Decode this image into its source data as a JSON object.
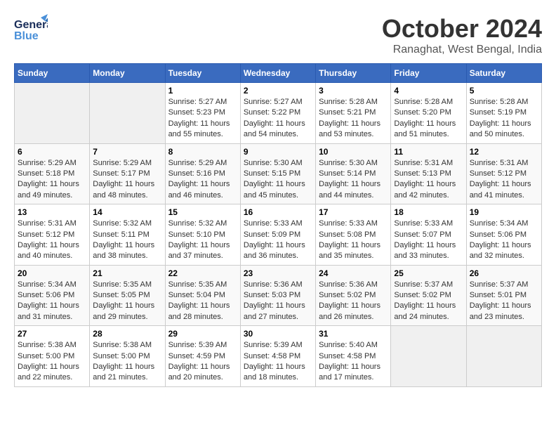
{
  "header": {
    "logo_general": "General",
    "logo_blue": "Blue",
    "month": "October 2024",
    "location": "Ranaghat, West Bengal, India"
  },
  "weekdays": [
    "Sunday",
    "Monday",
    "Tuesday",
    "Wednesday",
    "Thursday",
    "Friday",
    "Saturday"
  ],
  "weeks": [
    [
      {
        "day": "",
        "sunrise": "",
        "sunset": "",
        "daylight": "",
        "empty": true
      },
      {
        "day": "",
        "sunrise": "",
        "sunset": "",
        "daylight": "",
        "empty": true
      },
      {
        "day": "1",
        "sunrise": "Sunrise: 5:27 AM",
        "sunset": "Sunset: 5:23 PM",
        "daylight": "Daylight: 11 hours and 55 minutes.",
        "empty": false
      },
      {
        "day": "2",
        "sunrise": "Sunrise: 5:27 AM",
        "sunset": "Sunset: 5:22 PM",
        "daylight": "Daylight: 11 hours and 54 minutes.",
        "empty": false
      },
      {
        "day": "3",
        "sunrise": "Sunrise: 5:28 AM",
        "sunset": "Sunset: 5:21 PM",
        "daylight": "Daylight: 11 hours and 53 minutes.",
        "empty": false
      },
      {
        "day": "4",
        "sunrise": "Sunrise: 5:28 AM",
        "sunset": "Sunset: 5:20 PM",
        "daylight": "Daylight: 11 hours and 51 minutes.",
        "empty": false
      },
      {
        "day": "5",
        "sunrise": "Sunrise: 5:28 AM",
        "sunset": "Sunset: 5:19 PM",
        "daylight": "Daylight: 11 hours and 50 minutes.",
        "empty": false
      }
    ],
    [
      {
        "day": "6",
        "sunrise": "Sunrise: 5:29 AM",
        "sunset": "Sunset: 5:18 PM",
        "daylight": "Daylight: 11 hours and 49 minutes.",
        "empty": false
      },
      {
        "day": "7",
        "sunrise": "Sunrise: 5:29 AM",
        "sunset": "Sunset: 5:17 PM",
        "daylight": "Daylight: 11 hours and 48 minutes.",
        "empty": false
      },
      {
        "day": "8",
        "sunrise": "Sunrise: 5:29 AM",
        "sunset": "Sunset: 5:16 PM",
        "daylight": "Daylight: 11 hours and 46 minutes.",
        "empty": false
      },
      {
        "day": "9",
        "sunrise": "Sunrise: 5:30 AM",
        "sunset": "Sunset: 5:15 PM",
        "daylight": "Daylight: 11 hours and 45 minutes.",
        "empty": false
      },
      {
        "day": "10",
        "sunrise": "Sunrise: 5:30 AM",
        "sunset": "Sunset: 5:14 PM",
        "daylight": "Daylight: 11 hours and 44 minutes.",
        "empty": false
      },
      {
        "day": "11",
        "sunrise": "Sunrise: 5:31 AM",
        "sunset": "Sunset: 5:13 PM",
        "daylight": "Daylight: 11 hours and 42 minutes.",
        "empty": false
      },
      {
        "day": "12",
        "sunrise": "Sunrise: 5:31 AM",
        "sunset": "Sunset: 5:12 PM",
        "daylight": "Daylight: 11 hours and 41 minutes.",
        "empty": false
      }
    ],
    [
      {
        "day": "13",
        "sunrise": "Sunrise: 5:31 AM",
        "sunset": "Sunset: 5:12 PM",
        "daylight": "Daylight: 11 hours and 40 minutes.",
        "empty": false
      },
      {
        "day": "14",
        "sunrise": "Sunrise: 5:32 AM",
        "sunset": "Sunset: 5:11 PM",
        "daylight": "Daylight: 11 hours and 38 minutes.",
        "empty": false
      },
      {
        "day": "15",
        "sunrise": "Sunrise: 5:32 AM",
        "sunset": "Sunset: 5:10 PM",
        "daylight": "Daylight: 11 hours and 37 minutes.",
        "empty": false
      },
      {
        "day": "16",
        "sunrise": "Sunrise: 5:33 AM",
        "sunset": "Sunset: 5:09 PM",
        "daylight": "Daylight: 11 hours and 36 minutes.",
        "empty": false
      },
      {
        "day": "17",
        "sunrise": "Sunrise: 5:33 AM",
        "sunset": "Sunset: 5:08 PM",
        "daylight": "Daylight: 11 hours and 35 minutes.",
        "empty": false
      },
      {
        "day": "18",
        "sunrise": "Sunrise: 5:33 AM",
        "sunset": "Sunset: 5:07 PM",
        "daylight": "Daylight: 11 hours and 33 minutes.",
        "empty": false
      },
      {
        "day": "19",
        "sunrise": "Sunrise: 5:34 AM",
        "sunset": "Sunset: 5:06 PM",
        "daylight": "Daylight: 11 hours and 32 minutes.",
        "empty": false
      }
    ],
    [
      {
        "day": "20",
        "sunrise": "Sunrise: 5:34 AM",
        "sunset": "Sunset: 5:06 PM",
        "daylight": "Daylight: 11 hours and 31 minutes.",
        "empty": false
      },
      {
        "day": "21",
        "sunrise": "Sunrise: 5:35 AM",
        "sunset": "Sunset: 5:05 PM",
        "daylight": "Daylight: 11 hours and 29 minutes.",
        "empty": false
      },
      {
        "day": "22",
        "sunrise": "Sunrise: 5:35 AM",
        "sunset": "Sunset: 5:04 PM",
        "daylight": "Daylight: 11 hours and 28 minutes.",
        "empty": false
      },
      {
        "day": "23",
        "sunrise": "Sunrise: 5:36 AM",
        "sunset": "Sunset: 5:03 PM",
        "daylight": "Daylight: 11 hours and 27 minutes.",
        "empty": false
      },
      {
        "day": "24",
        "sunrise": "Sunrise: 5:36 AM",
        "sunset": "Sunset: 5:02 PM",
        "daylight": "Daylight: 11 hours and 26 minutes.",
        "empty": false
      },
      {
        "day": "25",
        "sunrise": "Sunrise: 5:37 AM",
        "sunset": "Sunset: 5:02 PM",
        "daylight": "Daylight: 11 hours and 24 minutes.",
        "empty": false
      },
      {
        "day": "26",
        "sunrise": "Sunrise: 5:37 AM",
        "sunset": "Sunset: 5:01 PM",
        "daylight": "Daylight: 11 hours and 23 minutes.",
        "empty": false
      }
    ],
    [
      {
        "day": "27",
        "sunrise": "Sunrise: 5:38 AM",
        "sunset": "Sunset: 5:00 PM",
        "daylight": "Daylight: 11 hours and 22 minutes.",
        "empty": false
      },
      {
        "day": "28",
        "sunrise": "Sunrise: 5:38 AM",
        "sunset": "Sunset: 5:00 PM",
        "daylight": "Daylight: 11 hours and 21 minutes.",
        "empty": false
      },
      {
        "day": "29",
        "sunrise": "Sunrise: 5:39 AM",
        "sunset": "Sunset: 4:59 PM",
        "daylight": "Daylight: 11 hours and 20 minutes.",
        "empty": false
      },
      {
        "day": "30",
        "sunrise": "Sunrise: 5:39 AM",
        "sunset": "Sunset: 4:58 PM",
        "daylight": "Daylight: 11 hours and 18 minutes.",
        "empty": false
      },
      {
        "day": "31",
        "sunrise": "Sunrise: 5:40 AM",
        "sunset": "Sunset: 4:58 PM",
        "daylight": "Daylight: 11 hours and 17 minutes.",
        "empty": false
      },
      {
        "day": "",
        "sunrise": "",
        "sunset": "",
        "daylight": "",
        "empty": true
      },
      {
        "day": "",
        "sunrise": "",
        "sunset": "",
        "daylight": "",
        "empty": true
      }
    ]
  ]
}
